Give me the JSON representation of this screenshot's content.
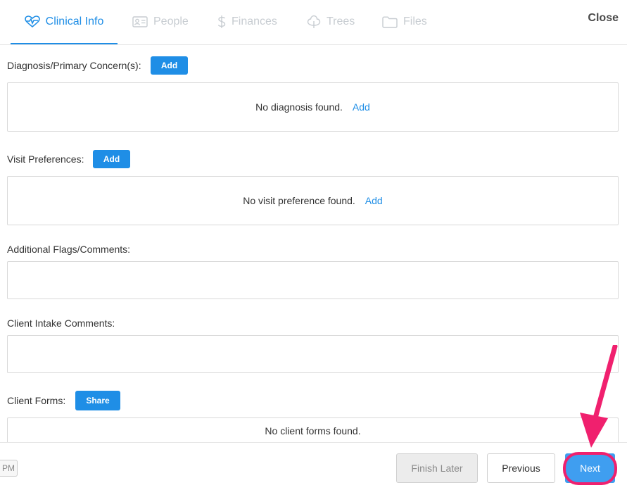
{
  "tabs": [
    {
      "label": "Clinical Info",
      "icon": "heartbeat-icon",
      "active": true
    },
    {
      "label": "People",
      "icon": "id-card-icon",
      "active": false
    },
    {
      "label": "Finances",
      "icon": "dollar-icon",
      "active": false
    },
    {
      "label": "Trees",
      "icon": "tree-icon",
      "active": false
    },
    {
      "label": "Files",
      "icon": "folder-icon",
      "active": false
    }
  ],
  "close_label": "Close",
  "diagnosis": {
    "label": "Diagnosis/Primary Concern(s):",
    "add_label": "Add",
    "empty_text": "No diagnosis found.",
    "empty_link": "Add"
  },
  "visit_prefs": {
    "label": "Visit Preferences:",
    "add_label": "Add",
    "empty_text": "No visit preference found.",
    "empty_link": "Add"
  },
  "flags": {
    "label": "Additional Flags/Comments:",
    "value": ""
  },
  "intake": {
    "label": "Client Intake Comments:",
    "value": ""
  },
  "client_forms": {
    "label": "Client Forms:",
    "share_label": "Share",
    "empty_text": "No client forms found."
  },
  "footer": {
    "time_suffix": "PM",
    "finish_later_label": "Finish Later",
    "previous_label": "Previous",
    "next_label": "Next"
  },
  "colors": {
    "accent": "#1f8ee6",
    "annotation": "#f0206e",
    "inactive_tab": "#c7ccd1"
  }
}
